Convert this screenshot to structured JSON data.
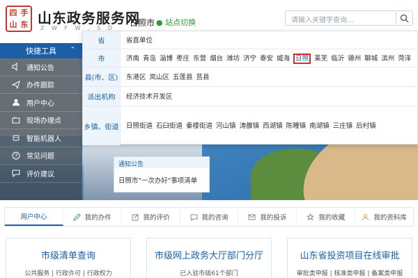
{
  "header": {
    "seal_chars": [
      "四",
      "手",
      "山",
      "东"
    ],
    "site_title": "山东政务服务网",
    "site_subtitle": "Z W F W . S D",
    "current_city": "日照市",
    "switch_site": "站点切换",
    "search": {
      "placeholder": "请输入关键字查询..."
    }
  },
  "sidebar": {
    "header": "快捷工具",
    "items": [
      {
        "label": "通知公告",
        "icon": "speaker-icon"
      },
      {
        "label": "办件跟踪",
        "icon": "send-icon"
      },
      {
        "label": "用户中心",
        "icon": "user-icon"
      },
      {
        "label": "现场办理点",
        "icon": "location-icon"
      },
      {
        "label": "智能机器人",
        "icon": "robot-icon"
      },
      {
        "label": "常见问题",
        "icon": "question-icon"
      },
      {
        "label": "评价建议",
        "icon": "comment-icon"
      }
    ]
  },
  "region_selector": {
    "rows": [
      {
        "label": "省",
        "values": [
          "省直单位"
        ]
      },
      {
        "label": "市",
        "values": [
          "济南",
          "青岛",
          "淄博",
          "枣庄",
          "东营",
          "烟台",
          "潍坊",
          "济宁",
          "泰安",
          "威海",
          "日照",
          "莱芜",
          "临沂",
          "德州",
          "聊城",
          "滨州",
          "菏泽"
        ],
        "selected": "日照"
      },
      {
        "label": "县(市、区)",
        "values": [
          "东港区",
          "岚山区",
          "五莲县",
          "莒县"
        ]
      },
      {
        "label": "派出机构",
        "values": [
          "经济技术开发区"
        ]
      },
      {
        "label": "乡镇、街道",
        "values": [
          "日照街道",
          "石臼街道",
          "秦楼街道",
          "河山镇",
          "涛雒镇",
          "西湖镇",
          "陈疃镇",
          "南湖镇",
          "三庄镇",
          "后村镇"
        ]
      }
    ]
  },
  "notice": {
    "header": "通知公告",
    "item": "日照市\"一次办好\"事项清单"
  },
  "user_tabs": [
    {
      "label": "用户中心",
      "icon": "",
      "active": true
    },
    {
      "label": "我的办件",
      "icon": "pencil-icon",
      "active": false
    },
    {
      "label": "我的评价",
      "icon": "edit-icon",
      "active": false
    },
    {
      "label": "我的咨询",
      "icon": "chat-icon",
      "active": false
    },
    {
      "label": "我的投诉",
      "icon": "mail-icon",
      "active": false
    },
    {
      "label": "我的收藏",
      "icon": "star-icon",
      "active": false
    },
    {
      "label": "我的资料库",
      "icon": "person-icon",
      "active": false
    }
  ],
  "cards": [
    {
      "title": "市级清单查询",
      "subtitle": "公共服务 | 行政许可 | 行政权力"
    },
    {
      "title": "市级网上政务大厅部门分厅",
      "subtitle": "已入驻市级61个部门"
    },
    {
      "title": "山东省投资项目在线审批",
      "subtitle": "审批类申报 | 核准类申报 | 备案类申报"
    }
  ],
  "colors": {
    "brand_blue": "#1b5fa6",
    "seal_red": "#c0392b",
    "switch_green": "#2a9d3a",
    "selected_red": "#d62c2c"
  }
}
